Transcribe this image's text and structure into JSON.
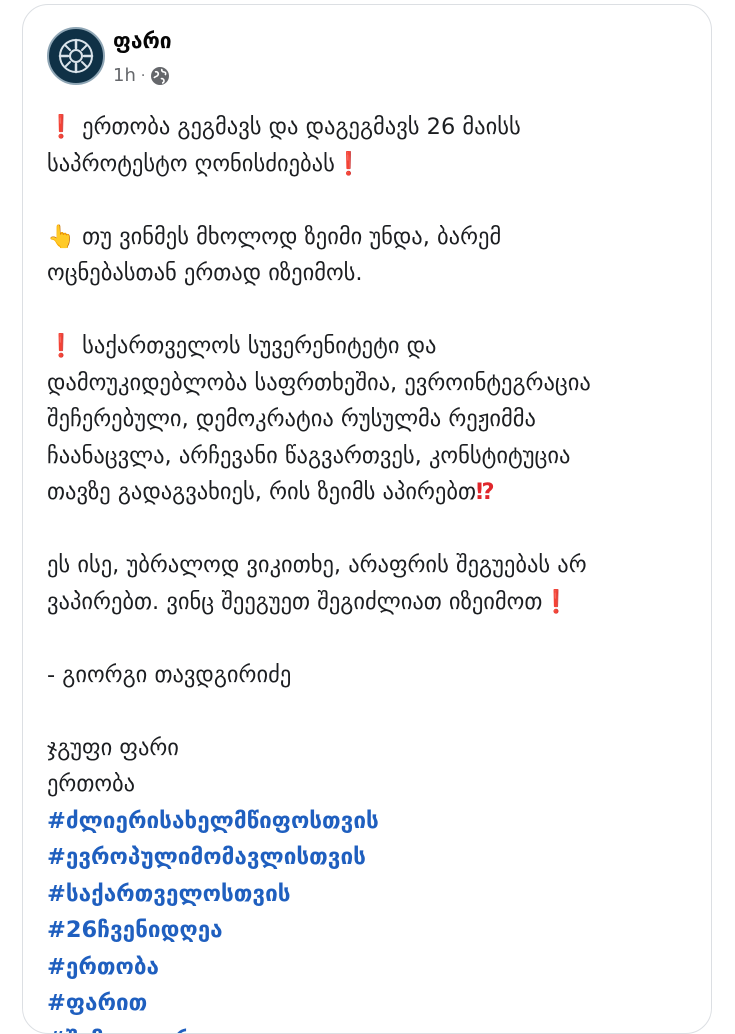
{
  "post": {
    "page_name": "ფარი",
    "time": "1h",
    "privacy_icon": "globe-icon",
    "colors": {
      "hashtag": "#1f5fbf",
      "red_emoji": "#e0262b"
    }
  },
  "emoji": {
    "exclamation": "❗",
    "hand": "👆",
    "interrobang": "⁉"
  },
  "paragraphs": {
    "p1": [
      "ერთობა გეგმავს და დაგეგმავს 26 მაისს",
      "საპროტესტო ღონისძიებას"
    ],
    "p2": [
      "თუ ვინმეს მხოლოდ ზეიმი უნდა, ბარემ",
      "ოცნებასთან ერთად იზეიმოს."
    ],
    "p3": [
      "საქართველოს სუვერენიტეტი და",
      "დამოუკიდებლობა საფრთხეშია, ევროინტეგრაცია",
      "შეჩერებული, დემოკრატია რუსულმა რეჟიმმა",
      "ჩაანაცვლა, არჩევანი წაგვართვეს, კონსტიტუცია",
      "თავზე გადაგვახიეს, რის ზეიმს აპირებთ"
    ],
    "p4": [
      "ეს ისე, უბრალოდ ვიკითხე, არაფრის შეგუებას არ",
      "ვაპირებთ.  ვინც შეეგუეთ შეგიძლიათ იზეიმოთ"
    ],
    "signature": "- გიორგი თავდგირიძე",
    "group_line": "ჯგუფი ფარი",
    "party_line": "ერთობა"
  },
  "hashtags": [
    "#ძლიერისახელმწიფოსთვის",
    "#ევროპულიმომავლისთვის",
    "#საქართველოსთვის",
    "#26ჩვენიდღეა",
    "#ერთობა",
    "#ფარით",
    "#შემოგვიერთდით"
  ]
}
